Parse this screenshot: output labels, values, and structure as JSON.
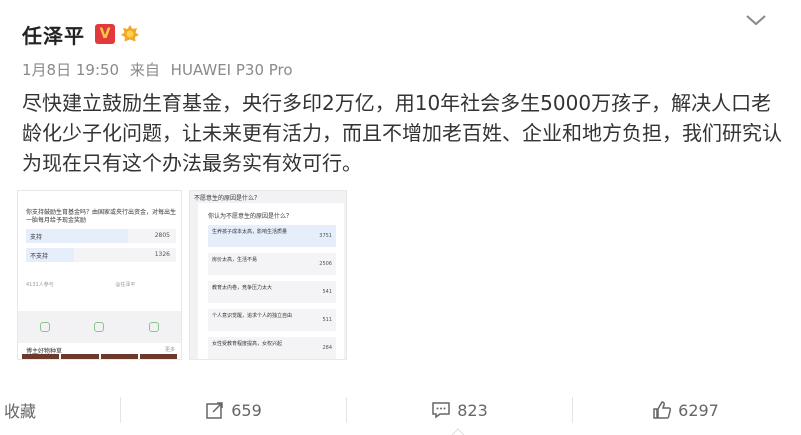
{
  "post": {
    "username": "任泽平",
    "verified_badge": "V",
    "date": "1月8日 19:50",
    "source_prefix": "来自",
    "source": "HUAWEI P30 Pro",
    "text": "尽快建立鼓励生育基金，央行多印2万亿，用10年社会多生5000万孩子，解决人口老龄化少子化问题，让未来更有活力，而且不增加老百姓、企业和地方负担，我们研究认为现在只有这个办法最务实有效可行。"
  },
  "poll1": {
    "question": "你支持鼓励生育基金吗？由国家或央行出资金，对每出生一胎每月给予现金奖励",
    "options": [
      {
        "label": "支持",
        "count": "2805",
        "share": 0.68
      },
      {
        "label": "不支持",
        "count": "1326",
        "share": 0.32
      }
    ],
    "footer": "4131人参与",
    "author": "@任泽平",
    "recommend_label": "博主好物种草",
    "recommend_more": "更多"
  },
  "poll2": {
    "title": "不愿意生的原因是什么？",
    "question": "你认为不愿意生的原因是什么？",
    "options": [
      {
        "label": "生养孩子成本太高，影响生活质量",
        "count": "3751"
      },
      {
        "label": "房价太高，生活不易",
        "count": "2506"
      },
      {
        "label": "教育太内卷，竞争压力太大",
        "count": "541"
      },
      {
        "label": "个人意识觉醒，追求个人的独立自由",
        "count": "511"
      },
      {
        "label": "女性受教育程度提高，女权兴起",
        "count": "284"
      }
    ]
  },
  "actions": {
    "favorite": "收藏",
    "repost": "659",
    "comment": "823",
    "like": "6297"
  },
  "colors": {
    "badge_red": "#e4393c",
    "badge_gold": "#f7c948",
    "medal_orange": "#f5a623",
    "meta_gray": "#8a8a8a"
  },
  "icons": [
    "chevron-down-icon",
    "verified-badge-icon",
    "medal-icon",
    "repost-icon",
    "comment-icon",
    "like-icon"
  ]
}
